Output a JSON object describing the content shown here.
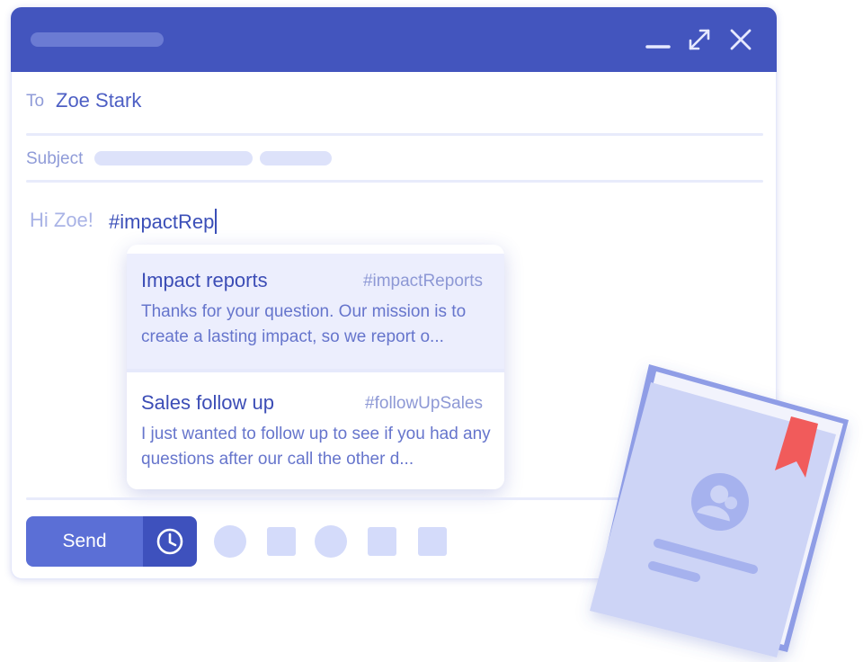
{
  "compose": {
    "to_label": "To",
    "to_value": "Zoe Stark",
    "subject_label": "Subject",
    "greeting": "Hi Zoe!",
    "typed_text": "#impactRep"
  },
  "suggestions": [
    {
      "title": "Impact reports",
      "tag": "#impactReports",
      "preview": "Thanks for your question. Our mission is to create a lasting impact, so we report o..."
    },
    {
      "title": "Sales follow up",
      "tag": "#followUpSales",
      "preview": "I just wanted to follow up to see if you had any questions after our call the other d..."
    }
  ],
  "toolbar": {
    "send_label": "Send"
  },
  "icons": {
    "minimize": "minimize-icon",
    "maximize": "expand-icon",
    "close": "close-icon",
    "schedule": "clock-icon",
    "book": "contact-book-icon"
  },
  "colors": {
    "header": "#4355be",
    "accent": "#5b6fd6",
    "accent_dark": "#3e51bd",
    "highlight": "#eceefd",
    "bookmark": "#f15b5b"
  }
}
